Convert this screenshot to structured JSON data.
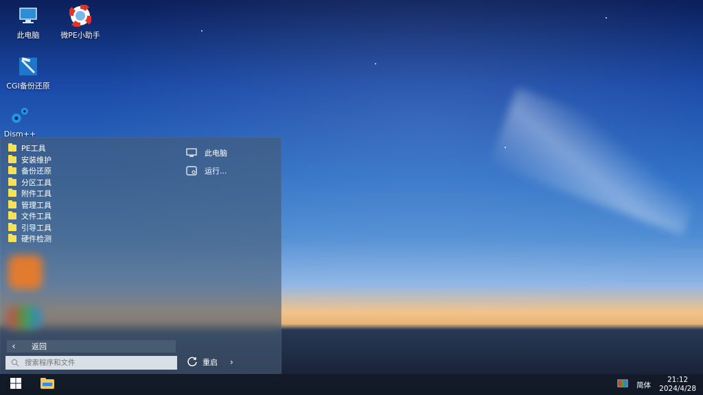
{
  "desktop": {
    "icons": [
      {
        "label": "此电脑",
        "icon": "computer-icon"
      },
      {
        "label": "微PE小助手",
        "icon": "lifebuoy-icon"
      },
      {
        "label": "CGI备份还原",
        "icon": "cgi-backup-icon"
      },
      {
        "label": "Dism++",
        "icon": "gears-icon"
      }
    ]
  },
  "start_menu": {
    "folders": [
      "PE工具",
      "安装维护",
      "备份还原",
      "分区工具",
      "附件工具",
      "管理工具",
      "文件工具",
      "引导工具",
      "硬件检测"
    ],
    "right_links": [
      {
        "label": "此电脑",
        "icon": "computer-icon"
      },
      {
        "label": "运行...",
        "icon": "run-icon"
      }
    ],
    "back_label": "返回",
    "search_placeholder": "搜索程序和文件",
    "restart_label": "重启"
  },
  "taskbar": {
    "ime_label": "简体",
    "time": "21:12",
    "date": "2024/4/28",
    "icons": [
      "windows-logo-icon",
      "file-explorer-icon",
      "network-status-icon"
    ]
  },
  "colors": {
    "folder": "#f7e15a",
    "menu_bg": "#465a73",
    "taskbar_bg": "#121a26"
  }
}
